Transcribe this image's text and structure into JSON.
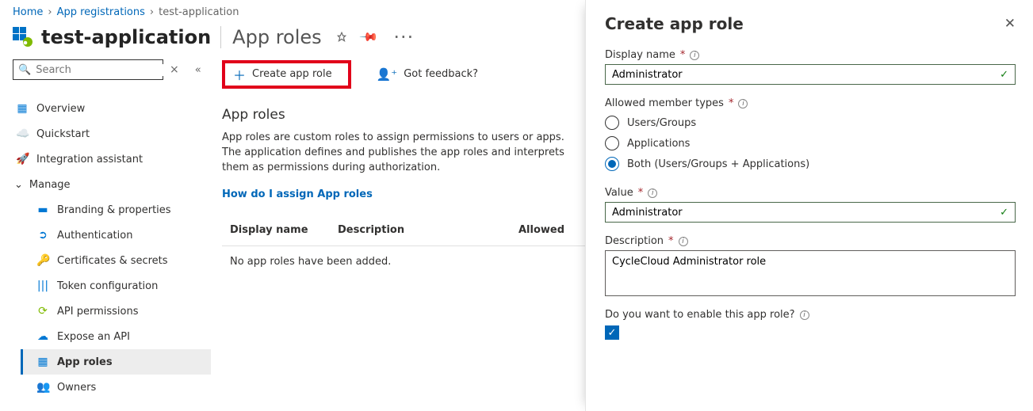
{
  "breadcrumb": {
    "items": [
      "Home",
      "App registrations",
      "test-application"
    ]
  },
  "header": {
    "title_main": "test-application",
    "title_sub": "App roles"
  },
  "search": {
    "placeholder": "Search"
  },
  "nav": {
    "overview": "Overview",
    "quickstart": "Quickstart",
    "integration": "Integration assistant",
    "manage": "Manage",
    "branding": "Branding & properties",
    "authentication": "Authentication",
    "certificates": "Certificates & secrets",
    "token": "Token configuration",
    "api_perm": "API permissions",
    "expose": "Expose an API",
    "app_roles": "App roles",
    "owners": "Owners"
  },
  "toolbar": {
    "create": "Create app role",
    "feedback": "Got feedback?"
  },
  "section": {
    "title": "App roles",
    "desc": "App roles are custom roles to assign permissions to users or apps. The application defines and publishes the app roles and interprets them as permissions during authorization.",
    "link": "How do I assign App roles"
  },
  "table": {
    "col_display": "Display name",
    "col_desc": "Description",
    "col_allowed": "Allowed",
    "empty": "No app roles have been added."
  },
  "panel": {
    "title": "Create app role",
    "display_name_label": "Display name",
    "display_name_value": "Administrator",
    "member_types_label": "Allowed member types",
    "member_opt_users": "Users/Groups",
    "member_opt_apps": "Applications",
    "member_opt_both": "Both (Users/Groups + Applications)",
    "value_label": "Value",
    "value_value": "Administrator",
    "description_label": "Description",
    "description_value": "CycleCloud Administrator role",
    "enable_label": "Do you want to enable this app role?",
    "enable_checked": true
  }
}
